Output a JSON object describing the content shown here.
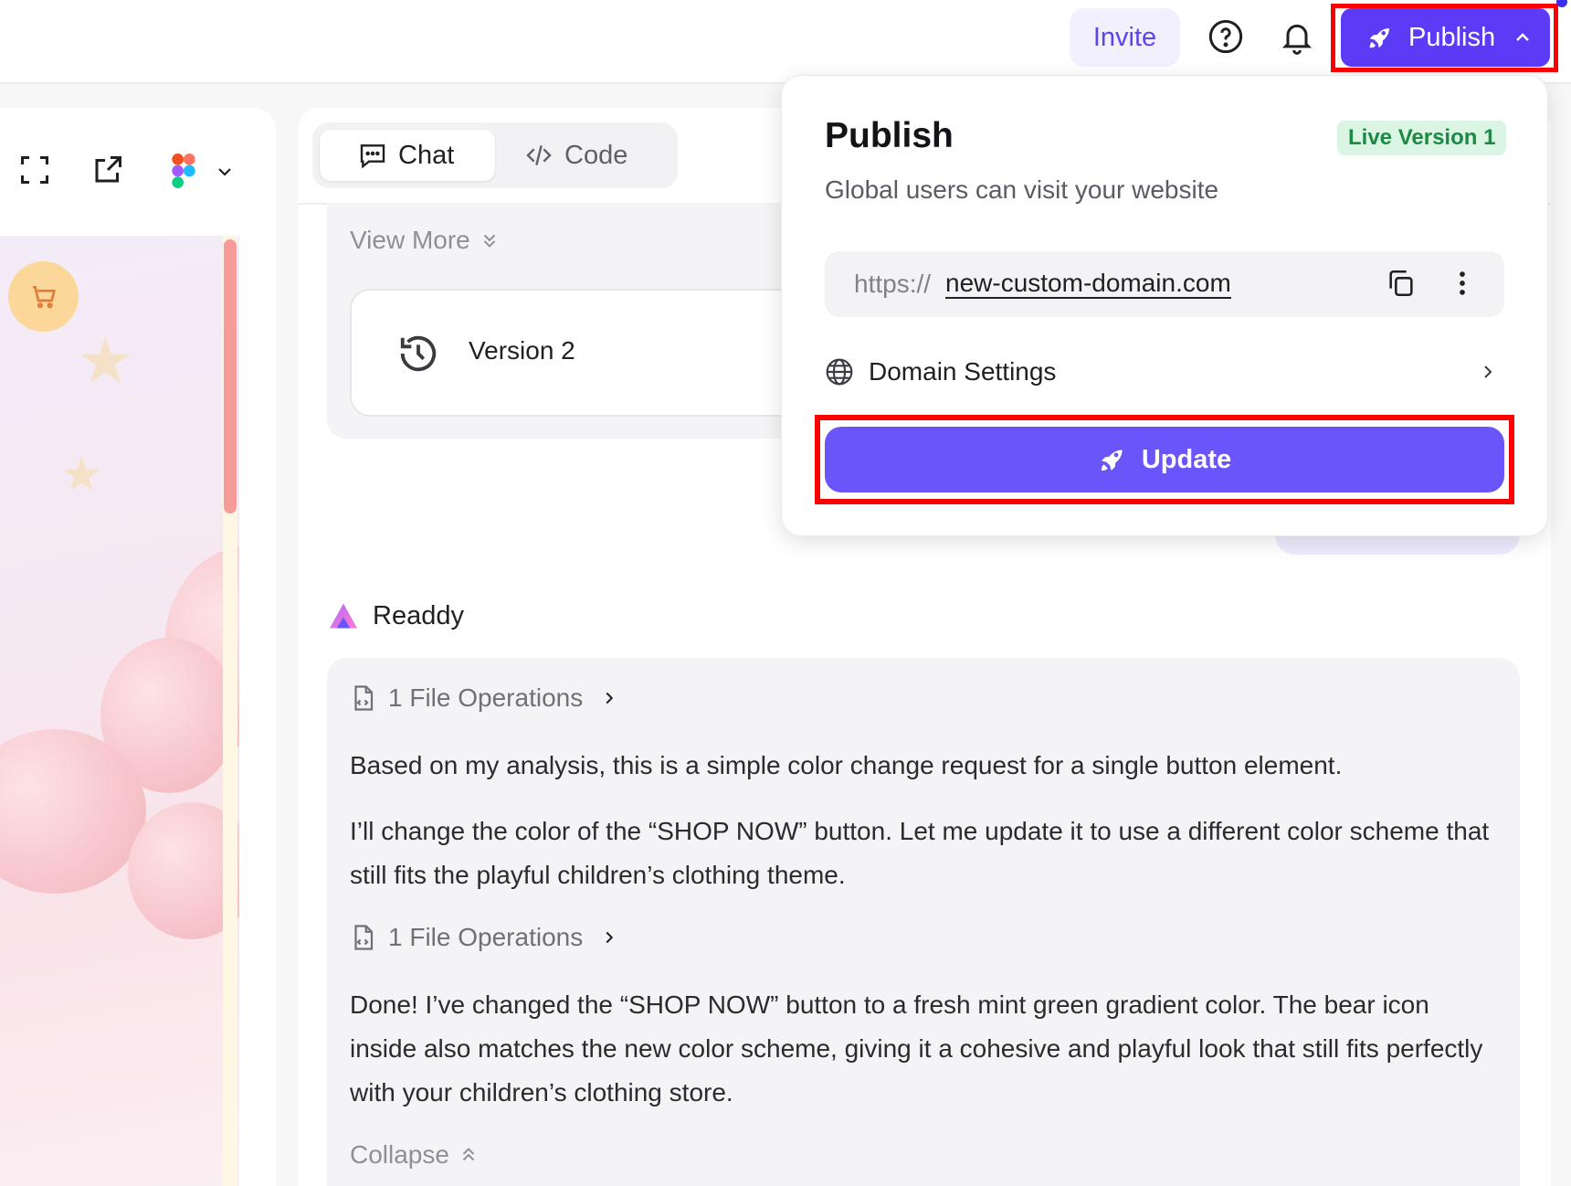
{
  "topbar": {
    "invite_label": "Invite",
    "publish_label": "Publish",
    "icons": [
      "help-circle-icon",
      "bell-icon",
      "rocket-icon",
      "chevron-up-icon"
    ]
  },
  "left_panel": {
    "toolbar_icons": [
      "fullscreen-icon",
      "external-link-icon",
      "figma-icon",
      "chevron-down-icon"
    ],
    "preview_icons": [
      "cart-icon",
      "star-icon"
    ]
  },
  "tabs": [
    {
      "label": "Chat",
      "icon": "chat-icon",
      "active": true
    },
    {
      "label": "Code",
      "icon": "code-icon",
      "active": false
    }
  ],
  "history": {
    "view_more_label": "View More",
    "version_label": "Version 2"
  },
  "assistant": {
    "name": "Readdy",
    "file_op_1": "1 File Operations",
    "message_1": "Based on my analysis, this is a simple color change request for a single button element.",
    "message_2": "I’ll change the color of the “SHOP NOW” button. Let me update it to use a different color scheme that still fits the playful children’s clothing theme.",
    "file_op_2": "1 File Operations",
    "message_3": "Done! I’ve changed the “SHOP NOW” button to a fresh mint green gradient color. The bear icon inside also matches the new color scheme, giving it a cohesive and playful look that still fits perfectly with your children’s clothing store.",
    "collapse_label": "Collapse"
  },
  "publish_popover": {
    "title": "Publish",
    "badge": "Live Version 1",
    "subtitle": "Global users can visit your website",
    "url_protocol": "https://",
    "url_domain": "new-custom-domain.com",
    "domain_settings_label": "Domain Settings",
    "update_label": "Update"
  },
  "colors": {
    "accent": "#5b3bf5",
    "update_button": "#6a55fa",
    "highlight": "#ff0000",
    "live_badge_bg": "#daf5e3",
    "live_badge_text": "#1c8a43"
  }
}
